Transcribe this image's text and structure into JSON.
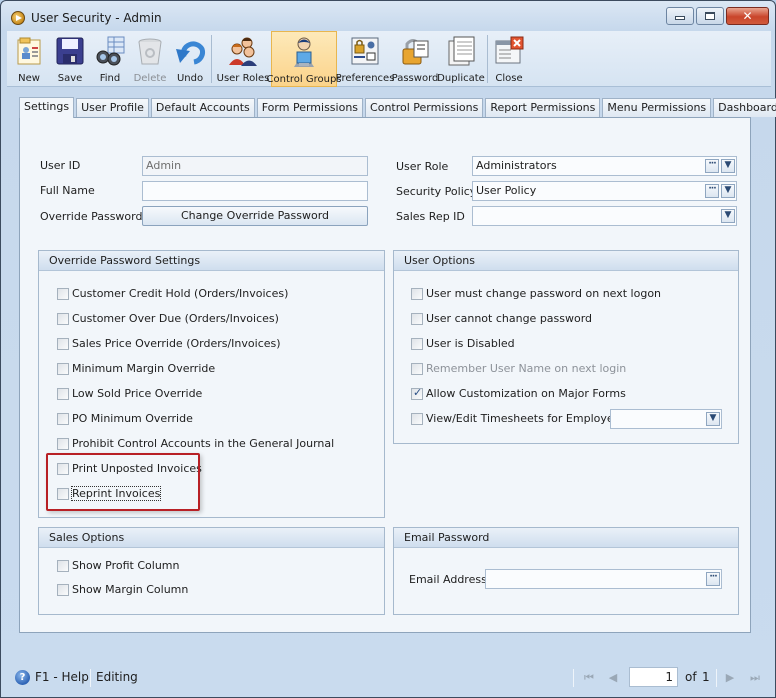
{
  "window": {
    "title": "User Security - Admin",
    "controls": {
      "minimize": "minimize",
      "maximize": "restore",
      "close": "close"
    }
  },
  "toolbar": {
    "items": [
      {
        "label": "New",
        "icon": "new-record-icon",
        "state": "normal"
      },
      {
        "label": "Save",
        "icon": "floppy-disk-icon",
        "state": "normal"
      },
      {
        "label": "Find",
        "icon": "binoculars-icon",
        "state": "normal"
      },
      {
        "label": "Delete",
        "icon": "recycle-bin-icon",
        "state": "disabled"
      },
      {
        "label": "Undo",
        "icon": "undo-arrow-icon",
        "state": "normal"
      },
      {
        "label": "User Roles",
        "icon": "user-group-icon",
        "state": "normal"
      },
      {
        "label": "Control Groups",
        "icon": "user-computer-icon",
        "state": "active"
      },
      {
        "label": "Preferences",
        "icon": "preferences-lock-icon",
        "state": "normal"
      },
      {
        "label": "Password",
        "icon": "padlock-icon",
        "state": "normal"
      },
      {
        "label": "Duplicate",
        "icon": "duplicate-pages-icon",
        "state": "normal"
      },
      {
        "label": "Close",
        "icon": "close-form-icon",
        "state": "normal"
      }
    ]
  },
  "tabs": [
    {
      "label": "Settings",
      "active": true
    },
    {
      "label": "User Profile",
      "active": false
    },
    {
      "label": "Default Accounts",
      "active": false
    },
    {
      "label": "Form Permissions",
      "active": false
    },
    {
      "label": "Control Permissions",
      "active": false
    },
    {
      "label": "Report Permissions",
      "active": false
    },
    {
      "label": "Menu Permissions",
      "active": false
    },
    {
      "label": "Dashboard Permissions",
      "active": false
    }
  ],
  "form": {
    "user_id": {
      "label": "User ID",
      "value": "Admin"
    },
    "full_name": {
      "label": "Full Name",
      "value": ""
    },
    "override_password": {
      "label": "Override Password",
      "button": "Change Override Password"
    },
    "user_role": {
      "label": "User Role",
      "value": "Administrators"
    },
    "security_policy": {
      "label": "Security Policy",
      "value": "User Policy"
    },
    "sales_rep_id": {
      "label": "Sales Rep ID",
      "value": ""
    }
  },
  "override_settings": {
    "title": "Override Password Settings",
    "items": [
      {
        "label": "Customer Credit Hold (Orders/Invoices)",
        "checked": false
      },
      {
        "label": "Customer Over Due (Orders/Invoices)",
        "checked": false
      },
      {
        "label": "Sales Price Override (Orders/Invoices)",
        "checked": false
      },
      {
        "label": "Minimum Margin Override",
        "checked": false
      },
      {
        "label": "Low Sold Price Override",
        "checked": false
      },
      {
        "label": "PO Minimum Override",
        "checked": false
      },
      {
        "label": "Prohibit Control Accounts in the General Journal",
        "checked": false
      },
      {
        "label": "Print Unposted Invoices",
        "checked": false
      },
      {
        "label": "Reprint Invoices",
        "checked": false
      }
    ]
  },
  "user_options": {
    "title": "User Options",
    "items": [
      {
        "label": "User must change password on next logon",
        "checked": false,
        "disabled": false
      },
      {
        "label": "User cannot change password",
        "checked": false,
        "disabled": false
      },
      {
        "label": "User is Disabled",
        "checked": false,
        "disabled": false
      },
      {
        "label": "Remember User Name on next login",
        "checked": false,
        "disabled": true
      },
      {
        "label": "Allow Customization on Major Forms",
        "checked": true,
        "disabled": false
      },
      {
        "label": "View/Edit Timesheets for Employee",
        "checked": false,
        "disabled": false
      }
    ],
    "employee_select_value": ""
  },
  "sales_options": {
    "title": "Sales Options",
    "items": [
      {
        "label": "Show Profit Column",
        "checked": false
      },
      {
        "label": "Show Margin Column",
        "checked": false
      }
    ]
  },
  "email_password": {
    "title": "Email Password",
    "email_label": "Email Address",
    "email_value": ""
  },
  "status": {
    "help": "F1 - Help",
    "mode": "Editing",
    "page": "1",
    "of_label": "of",
    "total_pages": "1"
  },
  "colors": {
    "highlight_box": "#b82025",
    "active_toolbar": "#fbd38a",
    "frame": "#c6d8ec"
  }
}
